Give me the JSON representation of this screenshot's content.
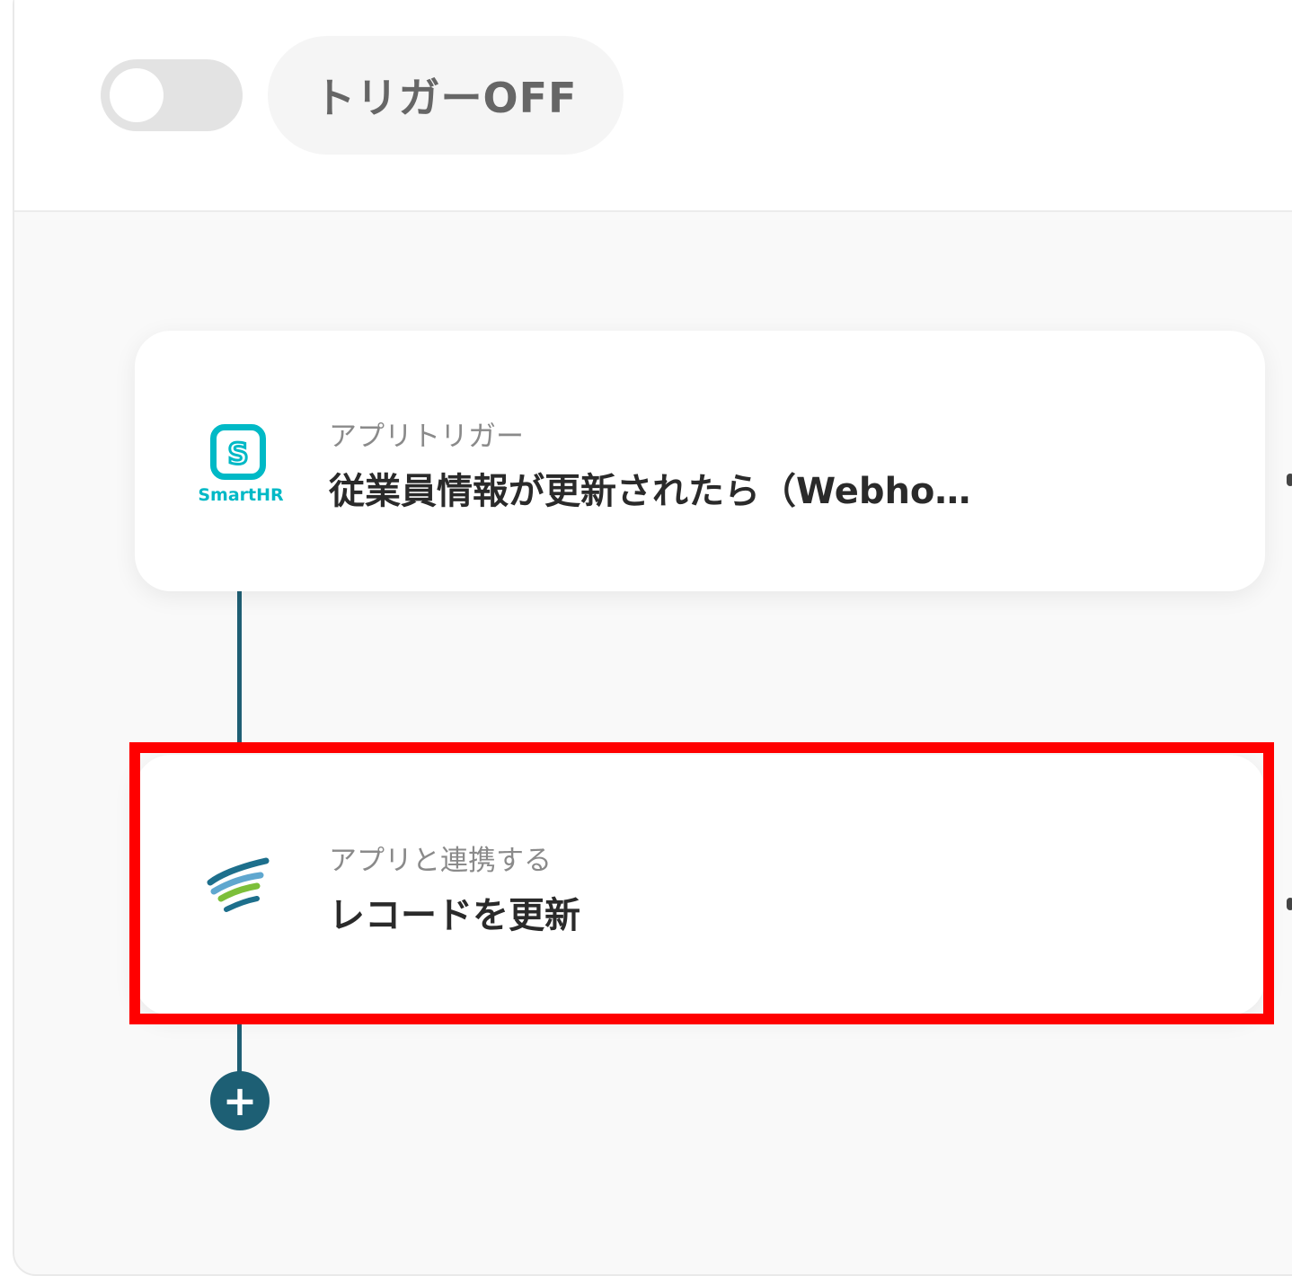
{
  "header": {
    "toggle_state": "off",
    "trigger_label": "トリガーOFF"
  },
  "flow": {
    "steps": [
      {
        "app": "SmartHR",
        "logo_text": "SmartHR",
        "logo_letter": "S",
        "subtitle": "アプリトリガー",
        "title": "従業員情報が更新されたら（Webho…"
      },
      {
        "app": "kintone-like app",
        "subtitle": "アプリと連携する",
        "title": "レコードを更新"
      }
    ],
    "add_step_symbol": "+"
  },
  "colors": {
    "smarthr": "#00b9c6",
    "connector": "#1f5f74",
    "highlight": "#ff0000"
  }
}
